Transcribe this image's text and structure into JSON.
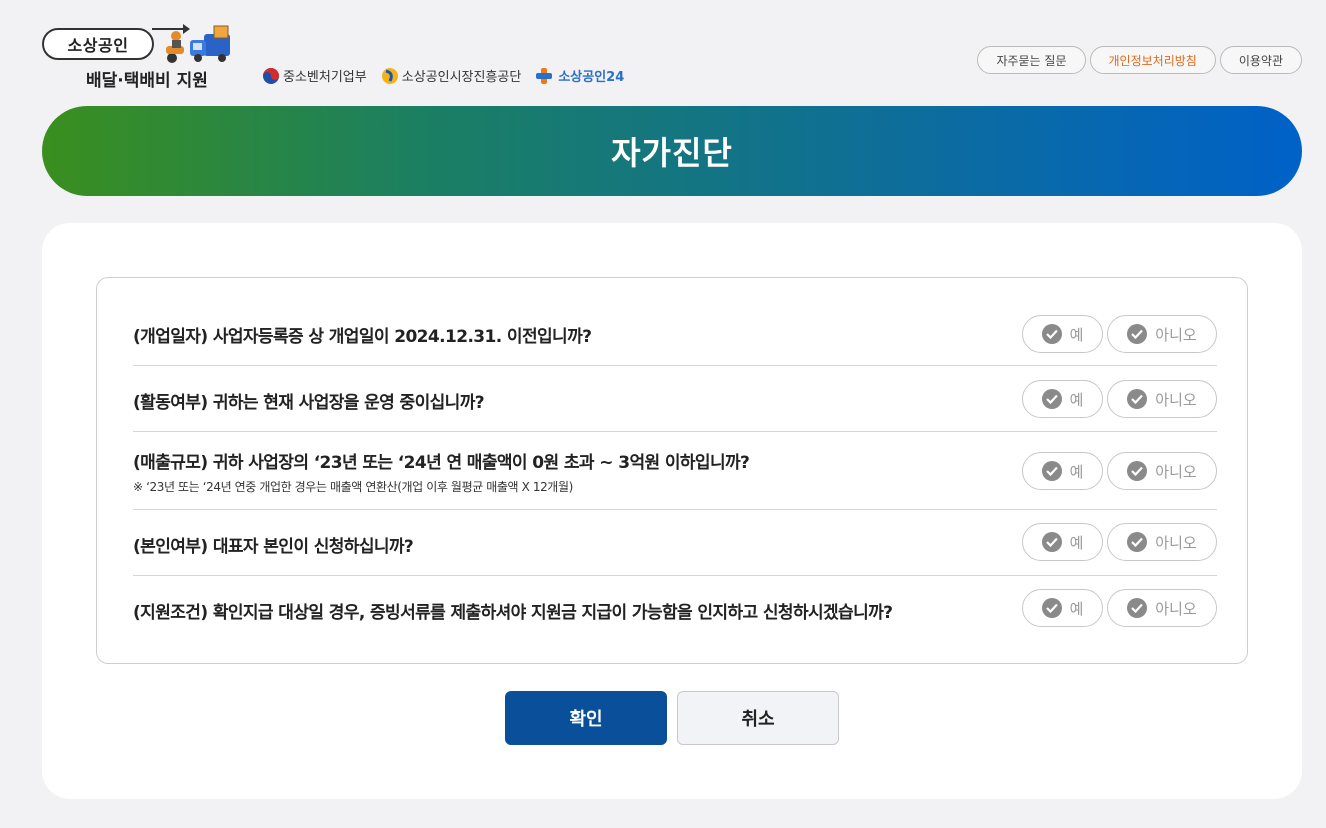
{
  "logo": {
    "top_label": "소상공인",
    "sub_label": "배달·택배비 지원"
  },
  "orgs": [
    {
      "label": "중소벤처기업부",
      "icon": "taegeuk-icon"
    },
    {
      "label": "소상공인시장진흥공단",
      "icon": "semas-icon"
    },
    {
      "label": "소상공인24",
      "icon": "sbiz24-icon"
    }
  ],
  "toplinks": {
    "faq": "자주묻는 질문",
    "privacy": "개인정보처리방침",
    "terms": "이용약관"
  },
  "banner": {
    "title": "자가진단"
  },
  "questions": [
    {
      "text": "(개업일자) 사업자등록증 상 개업일이 2024.12.31. 이전입니까?",
      "note": "",
      "yes": "예",
      "no": "아니오"
    },
    {
      "text": "(활동여부) 귀하는 현재 사업장을 운영 중이십니까?",
      "note": "",
      "yes": "예",
      "no": "아니오"
    },
    {
      "text": "(매출규모) 귀하 사업장의 ‘23년 또는 ‘24년 연 매출액이 0원 초과 ~ 3억원 이하입니까?",
      "note": "※ ‘23년 또는 ‘24년 연중 개업한 경우는 매출액 연환산(개업 이후 월평균 매출액 X 12개월)",
      "yes": "예",
      "no": "아니오"
    },
    {
      "text": "(본인여부) 대표자 본인이 신청하십니까?",
      "note": "",
      "yes": "예",
      "no": "아니오"
    },
    {
      "text": "(지원조건) 확인지급 대상일 경우, 증빙서류를 제출하셔야 지원금 지급이 가능함을 인지하고 신청하시겠습니까?",
      "note": "",
      "yes": "예",
      "no": "아니오"
    }
  ],
  "actions": {
    "confirm": "확인",
    "cancel": "취소"
  },
  "colors": {
    "primary": "#0a4f9a",
    "accent": "#e0691b",
    "banner_start": "#3a8f1e",
    "banner_end": "#0061c8"
  }
}
